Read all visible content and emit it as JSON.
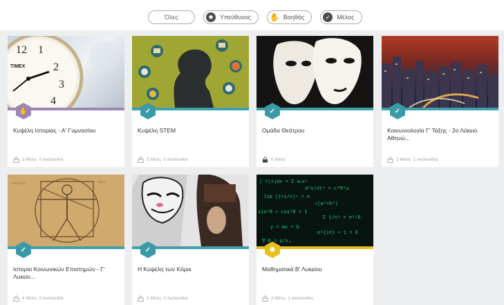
{
  "filters": {
    "all": "Όλες",
    "admin": "Υπεύθυνος",
    "helper": "Βοηθός",
    "member": "Μέλος"
  },
  "colors": {
    "teal": "#3a9aa8",
    "purple": "#9b86b4",
    "yellow": "#e7c01e",
    "card_bar_teal": "#3fa0ad",
    "card_bar_purple": "#9b86b4",
    "card_bar_yellow": "#e7c01e"
  },
  "cards": [
    {
      "title": "Κυψέλη Ιστορίας - Α' Γυμνασίου",
      "members": "5 Μέλη",
      "followers": "0 Ακόλουθοι",
      "role": "helper"
    },
    {
      "title": "Κυψέλη STEM",
      "members": "5 Μέλη",
      "followers": "0 Ακόλουθοι",
      "role": "member"
    },
    {
      "title": "Ομάδα Θεάτρου",
      "members": "5 Μέλη",
      "followers": "",
      "role": "member"
    },
    {
      "title": "Κοινωνιολογία Γ' Τάξης - 2ο Λύκειο Αθηνώ...",
      "members": "2 Μέλη",
      "followers": "1 Ακόλουθος",
      "role": "member"
    },
    {
      "title": "Ιστορία Κοινωνικών Επιστημών - Γ' Λυκείο...",
      "members": "4 Μέλη",
      "followers": "0 Ακόλουθοι",
      "role": "member"
    },
    {
      "title": "Η Κυψέλη των Κόμικ",
      "members": "5 Μέλη",
      "followers": "0 Ακόλουθοι",
      "role": "member"
    },
    {
      "title": "Μαθηματικά Β' Λυκείου",
      "members": "3 Μέλη",
      "followers": "1 Ακόλουθος",
      "role": "admin"
    }
  ]
}
